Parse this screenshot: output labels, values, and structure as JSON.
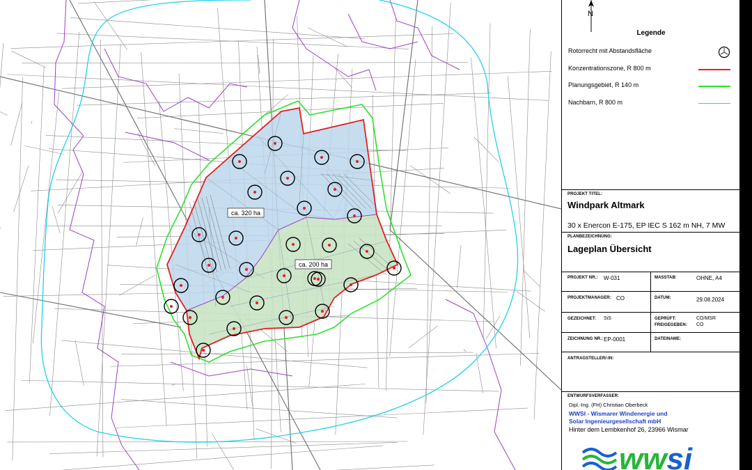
{
  "legend": {
    "north": "N",
    "title": "Legende",
    "items": [
      {
        "label": "Rotorrecht mit Abstandsfläche",
        "symbol": "rotor-circle",
        "color": "#000000"
      },
      {
        "label": "Konzentrationszone, R 800 m",
        "symbol": "line",
        "color": "#e02020"
      },
      {
        "label": "Planungsgebiet, R 140 m",
        "symbol": "line",
        "color": "#2ee02e"
      },
      {
        "label": "Nachbarn, R 800 m",
        "symbol": "line",
        "color": "#22d0e8"
      }
    ]
  },
  "map": {
    "area_north": "ca. 320 ha",
    "area_south": "ca. 200 ha",
    "area_north_color": "#bcd7ec",
    "area_south_color": "#c9e3c4",
    "turbine_count": 30
  },
  "title_block": {
    "projekt_titel_label": "PROJEKT TITEL:",
    "projekt_titel": "Windpark Altmark",
    "projekt_subtitle": "30 x Enercon E-175, EP IEC S 162 m NH, 7 MW",
    "planbezeichnung_label": "PLANBEZEICHNUNG:",
    "planbezeichnung": "Lageplan Übersicht",
    "projekt_nr_label": "PROJEKT NR.:",
    "projekt_nr": "W-031",
    "masstab_label": "MASSTAB:",
    "masstab": "OHNE, A4",
    "projektmanager_label": "PROJEKTMANAGER:",
    "projektmanager": "CO",
    "datum_label": "DATUM:",
    "datum": "29.08.2024",
    "gezeichnet_label": "GEZEICHNET:",
    "gezeichnet": "SiS",
    "geprueft_label": "GEPRÜFT:",
    "geprueft": "CO/MSR",
    "freigegeben_label": "FREIGEGEBEN:",
    "freigegeben": "CO",
    "zeichnung_nr_label": "ZEICHNUNG NR.:",
    "zeichnung_nr": "EP-0001",
    "dateiname_label": "DATEINAME:",
    "dateiname": "",
    "antragsteller_label": "ANTRAGSTELLER/-IN:",
    "antragsteller": "",
    "entwurfsverfasser_label": "ENTWURFSVERFASSER:",
    "verfasser_name": "Dipl.-Ing. (FH) Christian Oberbeck",
    "company_line1": "WWSI - Wismarer Windenergie und",
    "company_line2": "Solar Ingenieurgesellschaft mbH",
    "address": "Hinter dem Lembkenhof 26, 23966 Wismar",
    "logo_text": "wwsi"
  }
}
